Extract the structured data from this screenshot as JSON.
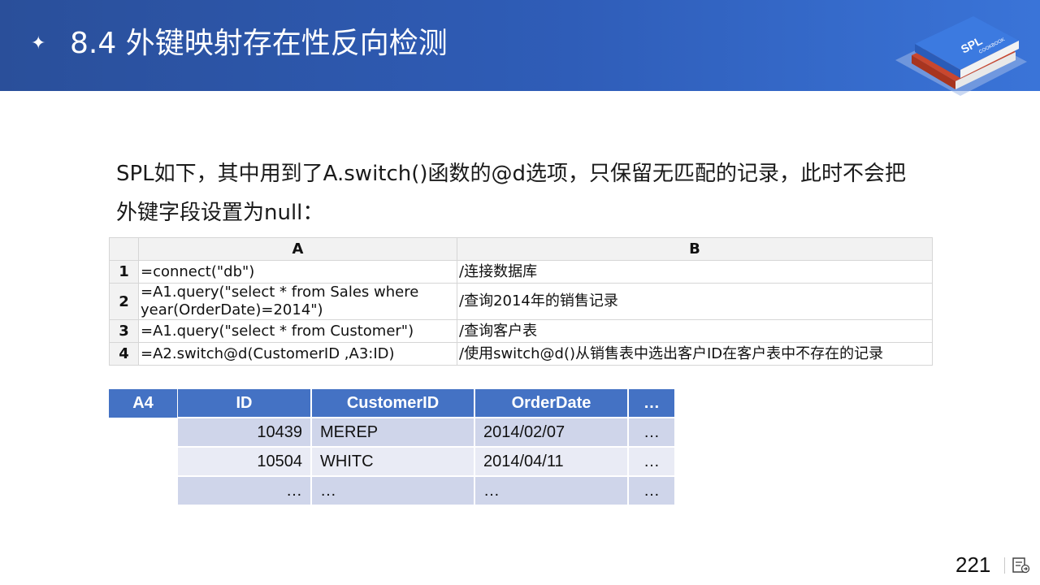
{
  "header": {
    "title": "8.4 外键映射存在性反向检测",
    "book_logo_text": "SPL",
    "book_logo_sub": "COOKBOOK"
  },
  "intro": {
    "line1": "SPL如下，其中用到了A.switch()函数的@d选项，只保留无匹配的记录，此时不会把",
    "line2": "外键字段设置为null："
  },
  "code_grid": {
    "columns": [
      "A",
      "B"
    ],
    "rows": [
      {
        "num": "1",
        "a": "=connect(\"db\")",
        "b": "/连接数据库"
      },
      {
        "num": "2",
        "a": "=A1.query(\"select * from Sales where year(OrderDate)=2014\")",
        "b": "/查询2014年的销售记录"
      },
      {
        "num": "3",
        "a": "=A1.query(\"select * from Customer\")",
        "b": "/查询客户表"
      },
      {
        "num": "4",
        "a": "=A2.switch@d(CustomerID ,A3:ID)",
        "b": "/使用switch@d()从销售表中选出客户ID在客户表中不存在的记录"
      }
    ]
  },
  "result": {
    "label": "A4",
    "headers": [
      "ID",
      "CustomerID",
      "OrderDate",
      "…"
    ],
    "rows": [
      [
        "10439",
        "MEREP",
        "2014/02/07",
        "…"
      ],
      [
        "10504",
        "WHITC",
        "2014/04/11",
        "…"
      ],
      [
        "…",
        "…",
        "…",
        "…"
      ]
    ]
  },
  "footer": {
    "page_number": "221",
    "nav_icon": "slide-menu-icon"
  }
}
